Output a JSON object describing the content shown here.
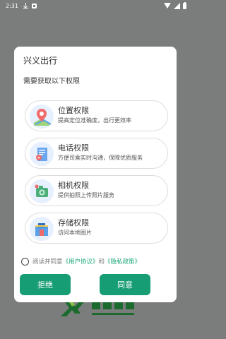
{
  "status_bar": {
    "time": "2:31"
  },
  "dialog": {
    "title": "兴义出行",
    "subtitle": "需要获取以下权限",
    "permissions": [
      {
        "title": "位置权限",
        "desc": "提高定位准确度，出行更效率",
        "icon": "location-pin-icon"
      },
      {
        "title": "电话权限",
        "desc": "方便司乘实时沟通，保障优质服务",
        "icon": "phone-document-icon"
      },
      {
        "title": "相机权限",
        "desc": "提供拍照上传照片服务",
        "icon": "camera-icon"
      },
      {
        "title": "存储权限",
        "desc": "访问本地图片",
        "icon": "storage-folder-icon"
      }
    ],
    "agreement": {
      "prefix": "阅读并同意",
      "user_agreement": "《用户协议》",
      "and": "和",
      "privacy_policy": "《隐私政策》"
    },
    "reject_label": "拒绝",
    "accept_label": "同意"
  },
  "colors": {
    "accent": "#179d74",
    "link": "#1aa77a",
    "overlay": "#7a7d7b"
  }
}
